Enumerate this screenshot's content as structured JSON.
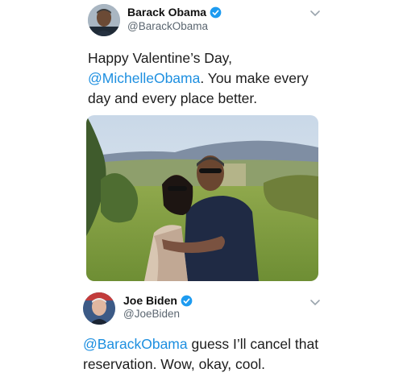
{
  "tweets": [
    {
      "display_name": "Barack Obama",
      "handle": "@BarackObama",
      "text_pre": "Happy Valentine’s Day,",
      "mention": "@MichelleObama",
      "text_post": ". You make every day and every place better."
    },
    {
      "display_name": "Joe Biden",
      "handle": "@JoeBiden",
      "mention": "@BarackObama",
      "text_post": " guess I’ll cancel that reservation. Wow, okay, cool."
    }
  ],
  "colors": {
    "link": "#1d8fe0",
    "verified": "#1d9bf0",
    "handle": "#5b6670"
  },
  "icons": {
    "verified": "verified-badge-icon",
    "menu": "chevron-down-icon"
  }
}
